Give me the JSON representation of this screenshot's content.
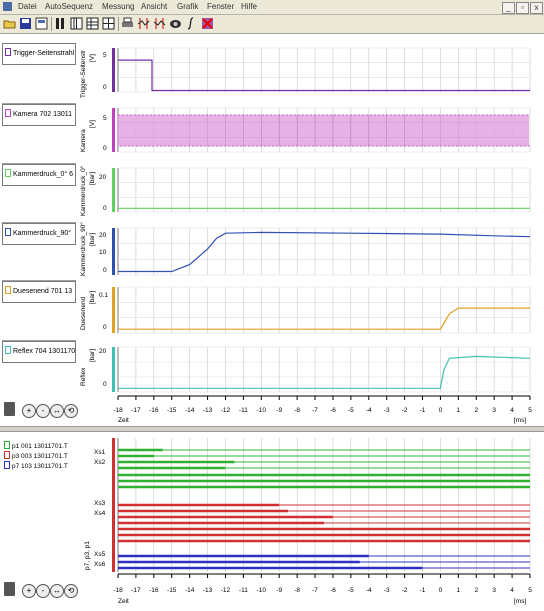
{
  "menu": {
    "items": [
      "Datei",
      "AutoSequenz",
      "Messung",
      "Ansicht",
      "Grafik",
      "Fenster",
      "Hilfe"
    ],
    "window_controls": [
      "_",
      "▫",
      "x"
    ]
  },
  "toolbar": {
    "icons": [
      "open-icon",
      "save-icon",
      "print-preview-icon",
      "columns-icon",
      "table-icon",
      "grid-icon",
      "printer-icon",
      "cursor-pair-icon",
      "cursor-pair-alt-icon",
      "scope-icon",
      "integral-icon",
      "delete-icon"
    ]
  },
  "channels": [
    {
      "name": "Trigger-Seitenstrahl",
      "axis_title": "Trigger-Seitenstr",
      "unit": "[V]",
      "yticks": [
        "5",
        "0"
      ],
      "color": "#7030a0"
    },
    {
      "name": "Kamera  702 13011",
      "axis_title": "Kamera",
      "unit": "[V]",
      "yticks": [
        "5",
        "0"
      ],
      "color": "#c040c0"
    },
    {
      "name": "Kammerdruck_0°  6",
      "axis_title": "Kammerdruck_0°",
      "unit": "[bar]",
      "yticks": [
        "20",
        "0"
      ],
      "color": "#60d060"
    },
    {
      "name": "Kammerdruck_90°",
      "axis_title": "Kammerdruck_90°",
      "unit": "[bar]",
      "yticks": [
        "20",
        "10",
        "0"
      ],
      "color": "#3050b0"
    },
    {
      "name": "Duesenend  701 13",
      "axis_title": "Duesenend",
      "unit": "[bar]",
      "yticks": [
        "0.1",
        "0"
      ],
      "color": "#e0a020"
    },
    {
      "name": "Reflex  704 1301170",
      "axis_title": "Reflex",
      "unit": "[bar]",
      "yticks": [
        "20",
        "0"
      ],
      "color": "#40c0b0"
    }
  ],
  "chart_data": {
    "type": "line",
    "x_axis_label": "Zeit",
    "x_unit": "[ms]",
    "xlim": [
      -18,
      5
    ],
    "x_ticks": [
      "-18",
      "-17",
      "-16",
      "-15",
      "-14",
      "-13",
      "-12",
      "-11",
      "-10",
      "-9",
      "-8",
      "-7",
      "-6",
      "-5",
      "-4",
      "-3",
      "-2",
      "-1",
      "0",
      "1",
      "2",
      "3",
      "4",
      "5"
    ],
    "series": [
      {
        "name": "Trigger-Seitenstrahl",
        "x": [
          -18,
          -16.1,
          -16.1,
          5
        ],
        "y": [
          4,
          4,
          0,
          0
        ]
      },
      {
        "name": "Kammerdruck_0°",
        "x": [
          -18,
          5
        ],
        "y": [
          0,
          0
        ]
      },
      {
        "name": "Kammerdruck_90°",
        "x": [
          -18,
          -15,
          -14,
          -13,
          -12.5,
          -12,
          -10,
          -5,
          0,
          3,
          5
        ],
        "y": [
          0,
          0,
          4,
          13,
          19,
          22,
          22.5,
          22,
          21.5,
          20.5,
          20
        ]
      },
      {
        "name": "Duesenend",
        "x": [
          -18,
          0,
          0.5,
          1,
          5
        ],
        "y": [
          0,
          0,
          0.04,
          0.055,
          0.055
        ]
      },
      {
        "name": "Reflex",
        "x": [
          -18,
          0,
          0.2,
          0.5,
          2,
          5
        ],
        "y": [
          0,
          0,
          10,
          16,
          17,
          16
        ]
      }
    ]
  },
  "lower_panel": {
    "legend": [
      {
        "label": "p1  001 13011701.T",
        "color": "#30b030"
      },
      {
        "label": "p3  003 13011701.T",
        "color": "#d03030"
      },
      {
        "label": "p7  103 13011701.T",
        "color": "#3030c0"
      }
    ],
    "axis_title": "p7, p3, p1",
    "cursor_labels": [
      "Xs1",
      "Xs2",
      "Xs3",
      "Xs4",
      "Xs5",
      "Xs6"
    ],
    "x_axis_label": "Zeit",
    "x_unit": "[ms]"
  }
}
